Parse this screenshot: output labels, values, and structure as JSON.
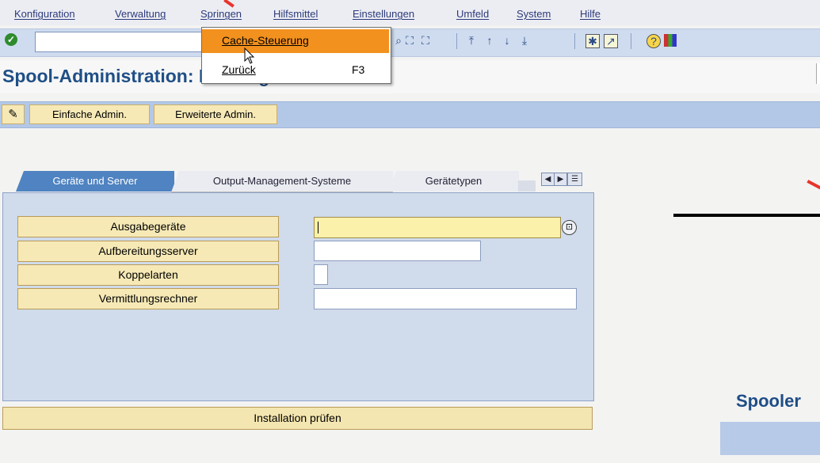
{
  "menubar": {
    "items": [
      "Konfiguration",
      "Verwaltung",
      "Springen",
      "Hilfsmittel",
      "Einstellungen",
      "Umfeld",
      "System",
      "Hilfe"
    ]
  },
  "dropdown": {
    "items": [
      {
        "label": "Cache-Steuerung",
        "shortcut": ""
      },
      {
        "label": "Zurück",
        "shortcut": "F3"
      }
    ]
  },
  "title": "Spool-Administration: Einstieg",
  "app_toolbar": {
    "simple_admin": "Einfache Admin.",
    "extended_admin": "Erweiterte Admin."
  },
  "tabs": [
    "Geräte und Server",
    "Output-Management-Systeme",
    "Gerätetypen"
  ],
  "objects": [
    "Ausgabegeräte",
    "Aufbereitungsserver",
    "Koppelarten",
    "Vermittlungsrechner"
  ],
  "install_button": "Installation prüfen",
  "right_window": {
    "title": "Spooler"
  },
  "colors": {
    "accent": "#f3911e",
    "title": "#1f4f86",
    "tab_active": "#4f83c1",
    "button": "#f6e9b6"
  }
}
